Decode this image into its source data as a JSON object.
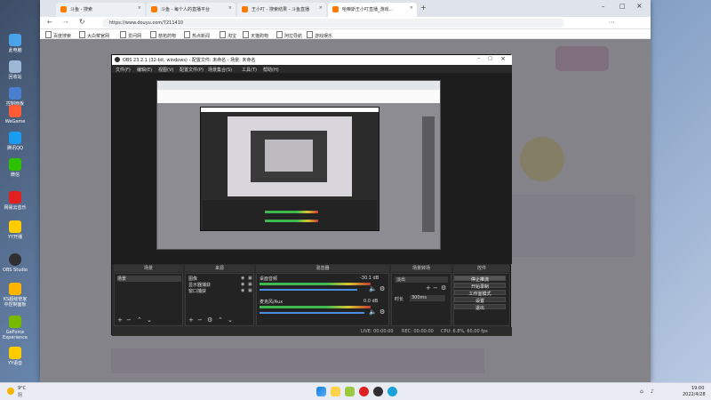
{
  "desktop": {
    "icons": [
      {
        "label": "此电脑",
        "color": "#4aa3e8"
      },
      {
        "label": "回收站",
        "color": "#9fb7d6"
      },
      {
        "label": "控制面板",
        "color": "#4a7fcf"
      },
      {
        "label": "WeGame",
        "color": "#ff5a36"
      },
      {
        "label": "腾讯QQ",
        "color": "#1a9cf0"
      },
      {
        "label": "微信",
        "color": "#2dc100"
      },
      {
        "label": "网易云音乐",
        "color": "#e02020"
      },
      {
        "label": "YY开播",
        "color": "#ffcc00"
      },
      {
        "label": "OBS Studio",
        "color": "#302e31"
      },
      {
        "label": "KS超级管家中控制面板",
        "color": "#ffb400"
      },
      {
        "label": "GeForce Experience",
        "color": "#76b900"
      },
      {
        "label": "YY语音",
        "color": "#ffcc00"
      }
    ]
  },
  "browser": {
    "tabs": [
      {
        "title": "斗鱼 - 搜索"
      },
      {
        "title": "斗鱼 - 每个人的直播平台"
      },
      {
        "title": "王小叮 - 搜索结果 - 斗鱼直播"
      },
      {
        "title": "哈嘛斯王小叮直播_游戏..."
      }
    ],
    "new_tab": "+",
    "url": "https://www.douyu.com/7211410",
    "bookmarks": [
      "百度搜索",
      "大白菜官网",
      "爱问网",
      "慈拓药物",
      "热点新闻",
      "淘宝",
      "天猫购物",
      "阿拉导航",
      "游戏娱乐"
    ]
  },
  "obs": {
    "title": "OBS 23.2.1 (32-bit, windows) - 配置文件: 未命名 - 场景: 未命名",
    "menu": [
      "文件(F)",
      "编辑(E)",
      "视图(V)",
      "配置文件(P)",
      "场景集合(S)",
      "工具(T)",
      "帮助(H)"
    ],
    "docks": {
      "scenes": {
        "title": "场景",
        "items": [
          "场景"
        ]
      },
      "sources": {
        "title": "来源",
        "items": [
          "图像",
          "显示器捕获",
          "窗口捕获"
        ]
      },
      "mixer": {
        "title": "混音器",
        "channels": [
          {
            "name": "桌面音频",
            "db": "-30.1 dB"
          },
          {
            "name": "麦克风/Aux",
            "db": "0.0 dB"
          }
        ]
      },
      "transitions": {
        "title": "场景转场",
        "type": "淡出",
        "duration_label": "时长",
        "duration": "300ms"
      },
      "controls": {
        "title": "控件",
        "buttons": [
          "停止推流",
          "开始录制",
          "工作室模式",
          "设置",
          "退出"
        ]
      }
    },
    "status": {
      "live": "LIVE: 00:00:00",
      "rec": "REC: 00:00:00",
      "cpu": "CPU: 6.8%, 60.00 fps"
    }
  },
  "taskbar": {
    "weather": {
      "temp": "9°C",
      "desc": "阴"
    },
    "time": "19:00",
    "date": "2022/4/28"
  }
}
